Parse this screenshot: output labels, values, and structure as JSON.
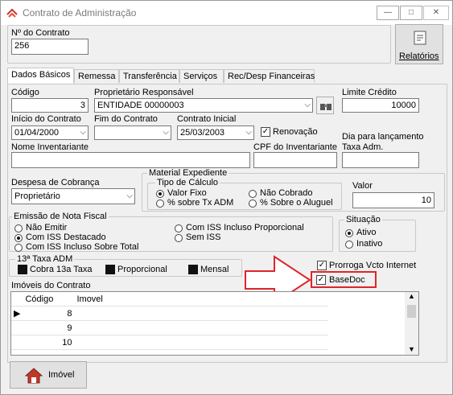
{
  "window": {
    "title": "Contrato de Administração"
  },
  "header": {
    "contract_number_label": "Nº do Contrato",
    "contract_number_value": "256",
    "reports_button": "Relatórios"
  },
  "tabs": [
    {
      "label": "Dados Básicos",
      "active": true
    },
    {
      "label": "Remessa"
    },
    {
      "label": "Transferência"
    },
    {
      "label": "Serviços"
    },
    {
      "label": "Rec/Desp Financeiras"
    }
  ],
  "form": {
    "codigo_label": "Código",
    "codigo_value": "3",
    "proprietario_label": "Proprietário Responsável",
    "proprietario_value": "ENTIDADE 00000003",
    "limite_label": "Limite Crédito",
    "limite_value": "10000",
    "inicio_label": "Início do Contrato",
    "inicio_value": "01/04/2000",
    "fim_label": "Fim do Contrato",
    "fim_value": "",
    "inicial_label": "Contrato Inicial",
    "inicial_value": "25/03/2003",
    "renovacao_label": "Renovação",
    "renovacao_checked": true,
    "dia_lancamento_label": "Dia para lançamento",
    "taxa_adm_label": "Taxa Adm.",
    "nome_inventariante_label": "Nome Inventariante",
    "cpf_inventariante_label": "CPF do Inventariante",
    "despesa_label": "Despesa de Cobrança",
    "despesa_value": "Proprietário"
  },
  "material": {
    "group_label": "Material Expediente",
    "tipo_label": "Tipo de Cálculo",
    "options": [
      {
        "label": "Valor Fixo",
        "selected": true
      },
      {
        "label": "Não Cobrado",
        "selected": false
      },
      {
        "label": "% sobre Tx ADM",
        "selected": false
      },
      {
        "label": "% Sobre o Aluguel",
        "selected": false
      }
    ],
    "valor_label": "Valor",
    "valor_value": "10"
  },
  "nota_fiscal": {
    "group_label": "Emissão de Nota Fiscal",
    "options": [
      {
        "label": "Não Emitir",
        "selected": false
      },
      {
        "label": "Com ISS Destacado",
        "selected": true
      },
      {
        "label": "Com ISS Incluso Sobre Total",
        "selected": false
      },
      {
        "label": "Com ISS Incluso Proporcional",
        "selected": false
      },
      {
        "label": "Sem ISS",
        "selected": false
      }
    ]
  },
  "situacao": {
    "group_label": "Situação",
    "options": [
      {
        "label": "Ativo",
        "selected": true
      },
      {
        "label": "Inativo",
        "selected": false
      }
    ]
  },
  "taxa13": {
    "group_label": "13ª Taxa ADM",
    "options": [
      {
        "label": "Cobra 13a Taxa"
      },
      {
        "label": "Proporcional"
      },
      {
        "label": "Mensal"
      }
    ]
  },
  "checkboxes": {
    "prorroga_label": "Prorroga Vcto Internet",
    "basedoc_label": "BaseDoc"
  },
  "imoveis": {
    "group_label": "Imóveis do Contrato",
    "columns": [
      "Código",
      "Imovel"
    ],
    "rows": [
      {
        "codigo": "8",
        "imovel": ""
      },
      {
        "codigo": "9",
        "imovel": ""
      },
      {
        "codigo": "10",
        "imovel": ""
      }
    ]
  },
  "footer": {
    "imovel_button": "Imóvel"
  },
  "colors": {
    "highlight": "#e0242a",
    "chrome": "#f0f0f0"
  }
}
